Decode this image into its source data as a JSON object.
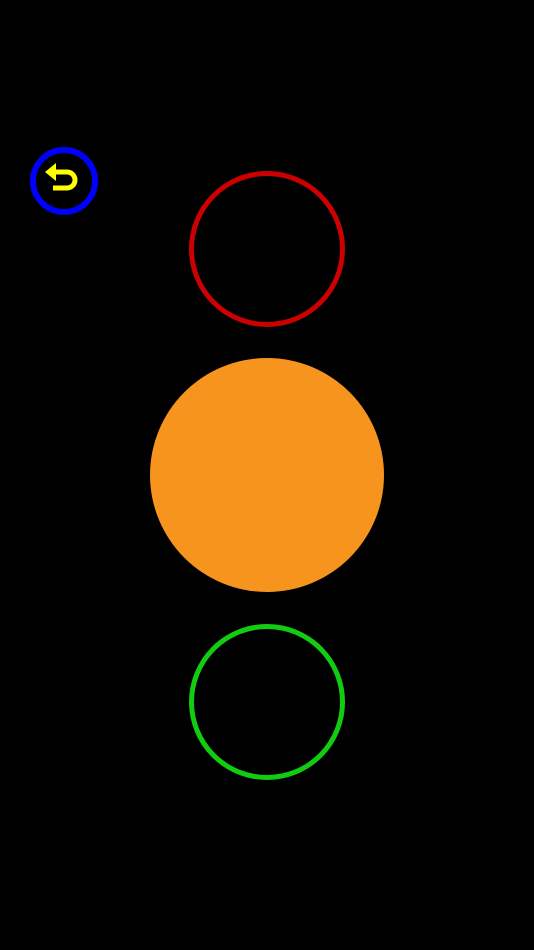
{
  "colors": {
    "background": "#000000",
    "back_button_ring": "#0000FF",
    "back_button_arrow": "#FFFF00",
    "red_light": "#CC0000",
    "amber_light": "#F7941E",
    "green_light": "#11CC11"
  },
  "back_button": {
    "icon": "undo-arrow-icon"
  },
  "traffic_light": {
    "lights": [
      {
        "name": "red",
        "lit": false
      },
      {
        "name": "amber",
        "lit": true
      },
      {
        "name": "green",
        "lit": false
      }
    ]
  }
}
